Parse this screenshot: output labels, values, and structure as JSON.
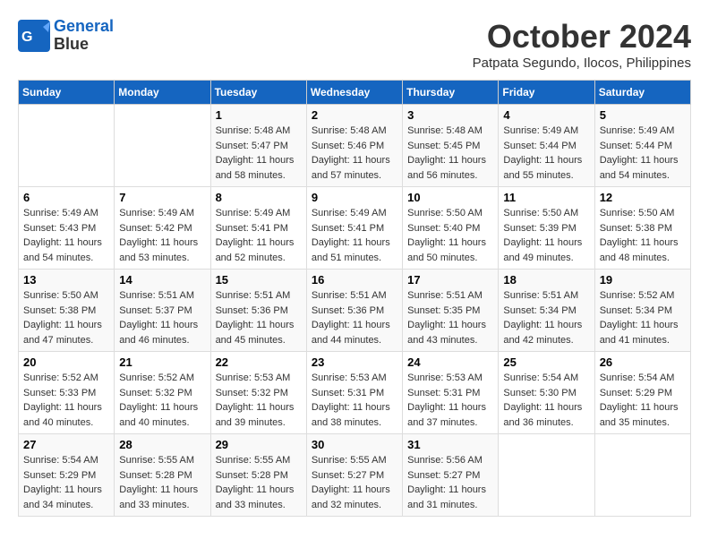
{
  "header": {
    "logo_line1": "General",
    "logo_line2": "Blue",
    "month": "October 2024",
    "location": "Patpata Segundo, Ilocos, Philippines"
  },
  "days_of_week": [
    "Sunday",
    "Monday",
    "Tuesday",
    "Wednesday",
    "Thursday",
    "Friday",
    "Saturday"
  ],
  "weeks": [
    [
      {
        "day": "",
        "info": ""
      },
      {
        "day": "",
        "info": ""
      },
      {
        "day": "1",
        "info": "Sunrise: 5:48 AM\nSunset: 5:47 PM\nDaylight: 11 hours and 58 minutes."
      },
      {
        "day": "2",
        "info": "Sunrise: 5:48 AM\nSunset: 5:46 PM\nDaylight: 11 hours and 57 minutes."
      },
      {
        "day": "3",
        "info": "Sunrise: 5:48 AM\nSunset: 5:45 PM\nDaylight: 11 hours and 56 minutes."
      },
      {
        "day": "4",
        "info": "Sunrise: 5:49 AM\nSunset: 5:44 PM\nDaylight: 11 hours and 55 minutes."
      },
      {
        "day": "5",
        "info": "Sunrise: 5:49 AM\nSunset: 5:44 PM\nDaylight: 11 hours and 54 minutes."
      }
    ],
    [
      {
        "day": "6",
        "info": "Sunrise: 5:49 AM\nSunset: 5:43 PM\nDaylight: 11 hours and 54 minutes."
      },
      {
        "day": "7",
        "info": "Sunrise: 5:49 AM\nSunset: 5:42 PM\nDaylight: 11 hours and 53 minutes."
      },
      {
        "day": "8",
        "info": "Sunrise: 5:49 AM\nSunset: 5:41 PM\nDaylight: 11 hours and 52 minutes."
      },
      {
        "day": "9",
        "info": "Sunrise: 5:49 AM\nSunset: 5:41 PM\nDaylight: 11 hours and 51 minutes."
      },
      {
        "day": "10",
        "info": "Sunrise: 5:50 AM\nSunset: 5:40 PM\nDaylight: 11 hours and 50 minutes."
      },
      {
        "day": "11",
        "info": "Sunrise: 5:50 AM\nSunset: 5:39 PM\nDaylight: 11 hours and 49 minutes."
      },
      {
        "day": "12",
        "info": "Sunrise: 5:50 AM\nSunset: 5:38 PM\nDaylight: 11 hours and 48 minutes."
      }
    ],
    [
      {
        "day": "13",
        "info": "Sunrise: 5:50 AM\nSunset: 5:38 PM\nDaylight: 11 hours and 47 minutes."
      },
      {
        "day": "14",
        "info": "Sunrise: 5:51 AM\nSunset: 5:37 PM\nDaylight: 11 hours and 46 minutes."
      },
      {
        "day": "15",
        "info": "Sunrise: 5:51 AM\nSunset: 5:36 PM\nDaylight: 11 hours and 45 minutes."
      },
      {
        "day": "16",
        "info": "Sunrise: 5:51 AM\nSunset: 5:36 PM\nDaylight: 11 hours and 44 minutes."
      },
      {
        "day": "17",
        "info": "Sunrise: 5:51 AM\nSunset: 5:35 PM\nDaylight: 11 hours and 43 minutes."
      },
      {
        "day": "18",
        "info": "Sunrise: 5:51 AM\nSunset: 5:34 PM\nDaylight: 11 hours and 42 minutes."
      },
      {
        "day": "19",
        "info": "Sunrise: 5:52 AM\nSunset: 5:34 PM\nDaylight: 11 hours and 41 minutes."
      }
    ],
    [
      {
        "day": "20",
        "info": "Sunrise: 5:52 AM\nSunset: 5:33 PM\nDaylight: 11 hours and 40 minutes."
      },
      {
        "day": "21",
        "info": "Sunrise: 5:52 AM\nSunset: 5:32 PM\nDaylight: 11 hours and 40 minutes."
      },
      {
        "day": "22",
        "info": "Sunrise: 5:53 AM\nSunset: 5:32 PM\nDaylight: 11 hours and 39 minutes."
      },
      {
        "day": "23",
        "info": "Sunrise: 5:53 AM\nSunset: 5:31 PM\nDaylight: 11 hours and 38 minutes."
      },
      {
        "day": "24",
        "info": "Sunrise: 5:53 AM\nSunset: 5:31 PM\nDaylight: 11 hours and 37 minutes."
      },
      {
        "day": "25",
        "info": "Sunrise: 5:54 AM\nSunset: 5:30 PM\nDaylight: 11 hours and 36 minutes."
      },
      {
        "day": "26",
        "info": "Sunrise: 5:54 AM\nSunset: 5:29 PM\nDaylight: 11 hours and 35 minutes."
      }
    ],
    [
      {
        "day": "27",
        "info": "Sunrise: 5:54 AM\nSunset: 5:29 PM\nDaylight: 11 hours and 34 minutes."
      },
      {
        "day": "28",
        "info": "Sunrise: 5:55 AM\nSunset: 5:28 PM\nDaylight: 11 hours and 33 minutes."
      },
      {
        "day": "29",
        "info": "Sunrise: 5:55 AM\nSunset: 5:28 PM\nDaylight: 11 hours and 33 minutes."
      },
      {
        "day": "30",
        "info": "Sunrise: 5:55 AM\nSunset: 5:27 PM\nDaylight: 11 hours and 32 minutes."
      },
      {
        "day": "31",
        "info": "Sunrise: 5:56 AM\nSunset: 5:27 PM\nDaylight: 11 hours and 31 minutes."
      },
      {
        "day": "",
        "info": ""
      },
      {
        "day": "",
        "info": ""
      }
    ]
  ]
}
